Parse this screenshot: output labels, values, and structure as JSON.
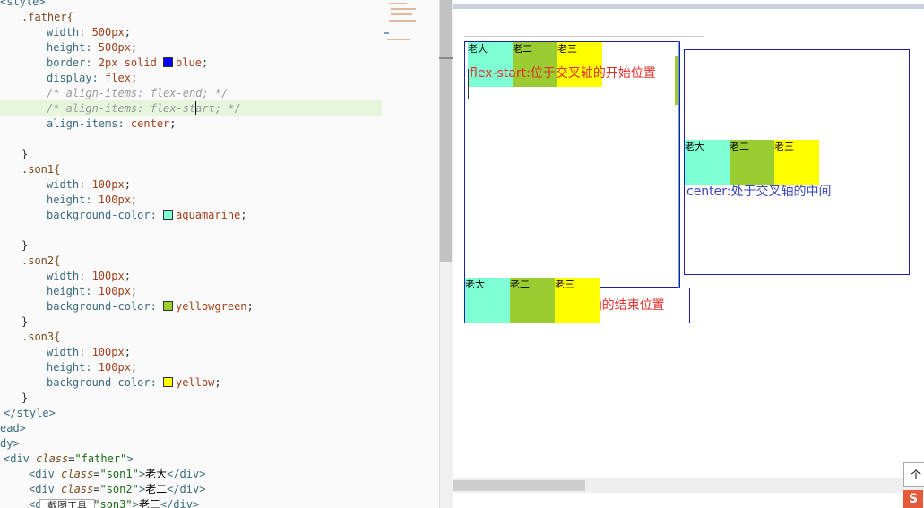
{
  "editor": {
    "lines": [
      {
        "indent": 0,
        "parts": [
          {
            "t": "<style>",
            "c": "#3a6b7c"
          }
        ]
      },
      {
        "indent": 24,
        "parts": [
          {
            "t": ".father{",
            "c": "#7a4a1a"
          }
        ]
      },
      {
        "indent": 52,
        "parts": [
          {
            "t": "width: ",
            "c": "#3a6b7c"
          },
          {
            "t": "500px",
            "c": "#a0401a"
          },
          {
            "t": ";",
            "c": "#333"
          }
        ]
      },
      {
        "indent": 52,
        "parts": [
          {
            "t": "height: ",
            "c": "#3a6b7c"
          },
          {
            "t": "500px",
            "c": "#a0401a"
          },
          {
            "t": ";",
            "c": "#333"
          }
        ]
      },
      {
        "indent": 52,
        "parts": [
          {
            "t": "border: ",
            "c": "#3a6b7c"
          },
          {
            "t": "2px solid ",
            "c": "#a0401a"
          },
          {
            "sw": "#0000ff"
          },
          {
            "t": "blue",
            "c": "#a0401a"
          },
          {
            "t": ";",
            "c": "#333"
          }
        ]
      },
      {
        "indent": 52,
        "parts": [
          {
            "t": "display: ",
            "c": "#3a6b7c"
          },
          {
            "t": "flex",
            "c": "#a0401a"
          },
          {
            "t": ";",
            "c": "#333"
          }
        ]
      },
      {
        "indent": 52,
        "parts": [
          {
            "t": "/* align-items: flex-end; */",
            "c": "#9a9a9a",
            "i": true
          }
        ]
      },
      {
        "indent": 52,
        "parts": [
          {
            "t": "/* align-items: flex-start; */",
            "c": "#9a9a9a",
            "i": true
          }
        ]
      },
      {
        "indent": 52,
        "parts": [
          {
            "t": "align-items: ",
            "c": "#3a6b7c"
          },
          {
            "t": "center",
            "c": "#a0401a"
          },
          {
            "t": ";",
            "c": "#333"
          }
        ]
      },
      {
        "indent": 0,
        "parts": []
      },
      {
        "indent": 24,
        "parts": [
          {
            "t": "}",
            "c": "#333"
          }
        ]
      },
      {
        "indent": 24,
        "parts": [
          {
            "t": ".son1{",
            "c": "#7a4a1a"
          }
        ]
      },
      {
        "indent": 52,
        "parts": [
          {
            "t": "width: ",
            "c": "#3a6b7c"
          },
          {
            "t": "100px",
            "c": "#a0401a"
          },
          {
            "t": ";",
            "c": "#333"
          }
        ]
      },
      {
        "indent": 52,
        "parts": [
          {
            "t": "height: ",
            "c": "#3a6b7c"
          },
          {
            "t": "100px",
            "c": "#a0401a"
          },
          {
            "t": ";",
            "c": "#333"
          }
        ]
      },
      {
        "indent": 52,
        "parts": [
          {
            "t": "background-color: ",
            "c": "#3a6b7c"
          },
          {
            "sw": "#7fffd4"
          },
          {
            "t": "aquamarine",
            "c": "#a0401a"
          },
          {
            "t": ";",
            "c": "#333"
          }
        ]
      },
      {
        "indent": 0,
        "parts": []
      },
      {
        "indent": 24,
        "parts": [
          {
            "t": "}",
            "c": "#333"
          }
        ]
      },
      {
        "indent": 24,
        "parts": [
          {
            "t": ".son2{",
            "c": "#7a4a1a"
          }
        ]
      },
      {
        "indent": 52,
        "parts": [
          {
            "t": "width: ",
            "c": "#3a6b7c"
          },
          {
            "t": "100px",
            "c": "#a0401a"
          },
          {
            "t": ";",
            "c": "#333"
          }
        ]
      },
      {
        "indent": 52,
        "parts": [
          {
            "t": "height: ",
            "c": "#3a6b7c"
          },
          {
            "t": "100px",
            "c": "#a0401a"
          },
          {
            "t": ";",
            "c": "#333"
          }
        ]
      },
      {
        "indent": 52,
        "parts": [
          {
            "t": "background-color: ",
            "c": "#3a6b7c"
          },
          {
            "sw": "#9acd32"
          },
          {
            "t": "yellowgreen",
            "c": "#a0401a"
          },
          {
            "t": ";",
            "c": "#333"
          }
        ]
      },
      {
        "indent": 24,
        "parts": [
          {
            "t": "}",
            "c": "#333"
          }
        ]
      },
      {
        "indent": 24,
        "parts": [
          {
            "t": ".son3{",
            "c": "#7a4a1a"
          }
        ]
      },
      {
        "indent": 52,
        "parts": [
          {
            "t": "width: ",
            "c": "#3a6b7c"
          },
          {
            "t": "100px",
            "c": "#a0401a"
          },
          {
            "t": ";",
            "c": "#333"
          }
        ]
      },
      {
        "indent": 52,
        "parts": [
          {
            "t": "height: ",
            "c": "#3a6b7c"
          },
          {
            "t": "100px",
            "c": "#a0401a"
          },
          {
            "t": ";",
            "c": "#333"
          }
        ]
      },
      {
        "indent": 52,
        "parts": [
          {
            "t": "background-color: ",
            "c": "#3a6b7c"
          },
          {
            "sw": "#ffff00"
          },
          {
            "t": "yellow",
            "c": "#a0401a"
          },
          {
            "t": ";",
            "c": "#333"
          }
        ]
      },
      {
        "indent": 24,
        "parts": [
          {
            "t": "}",
            "c": "#333"
          }
        ]
      },
      {
        "indent": 4,
        "parts": [
          {
            "t": "</style>",
            "c": "#3a6b7c"
          }
        ]
      },
      {
        "indent": 0,
        "parts": [
          {
            "t": "ead>",
            "c": "#3a6b7c"
          }
        ]
      },
      {
        "indent": 0,
        "parts": [
          {
            "t": "dy>",
            "c": "#3a6b7c"
          }
        ]
      },
      {
        "indent": 4,
        "parts": [
          {
            "t": "<div ",
            "c": "#3a6b7c"
          },
          {
            "t": "class",
            "c": "#7a4a1a",
            "i": true
          },
          {
            "t": "=",
            "c": "#333"
          },
          {
            "t": "\"father\"",
            "c": "#1a6a1a"
          },
          {
            "t": ">",
            "c": "#3a6b7c"
          }
        ]
      },
      {
        "indent": 32,
        "parts": [
          {
            "t": "<div ",
            "c": "#3a6b7c"
          },
          {
            "t": "class",
            "c": "#7a4a1a",
            "i": true
          },
          {
            "t": "=",
            "c": "#333"
          },
          {
            "t": "\"son1\"",
            "c": "#1a6a1a"
          },
          {
            "t": ">",
            "c": "#3a6b7c"
          },
          {
            "t": "老大",
            "c": "#000"
          },
          {
            "t": "</div>",
            "c": "#3a6b7c"
          }
        ]
      },
      {
        "indent": 32,
        "parts": [
          {
            "t": "<div ",
            "c": "#3a6b7c"
          },
          {
            "t": "class",
            "c": "#7a4a1a",
            "i": true
          },
          {
            "t": "=",
            "c": "#333"
          },
          {
            "t": "\"son2\"",
            "c": "#1a6a1a"
          },
          {
            "t": ">",
            "c": "#3a6b7c"
          },
          {
            "t": "老二",
            "c": "#000"
          },
          {
            "t": "</div>",
            "c": "#3a6b7c"
          }
        ]
      },
      {
        "indent": 32,
        "parts": [
          {
            "t": "<d",
            "c": "#3a6b7c"
          },
          {
            "t": "        ",
            "c": "#000"
          },
          {
            "t": "\"son3\"",
            "c": "#1a6a1a"
          },
          {
            "t": ">",
            "c": "#3a6b7c"
          },
          {
            "t": "老三",
            "c": "#000"
          },
          {
            "t": "</div>",
            "c": "#3a6b7c"
          }
        ]
      }
    ],
    "tooltip": "截图工具"
  },
  "preview": {
    "labels": {
      "a": "老大",
      "b": "老二",
      "c": "老三"
    },
    "flex_start_caption": "flex-start:位于交叉轴的开始位置",
    "flex_end_caption": "flex-end:位于交叉轴的结束位置",
    "center_caption": "center:处于交叉轴的中间",
    "corner_button": "个",
    "corner_logo": "S"
  }
}
